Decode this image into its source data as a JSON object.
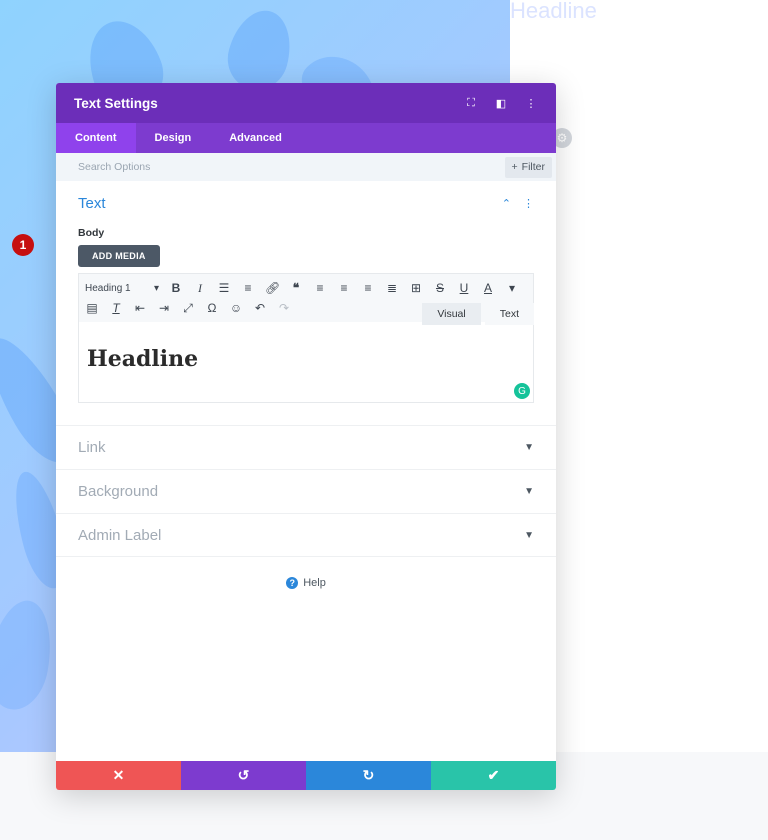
{
  "background": {
    "headline": "Headline"
  },
  "modal": {
    "title": "Text Settings",
    "header_icons": [
      "expand-icon",
      "sidebar-icon",
      "more-icon"
    ],
    "tabs": [
      {
        "label": "Content",
        "active": true
      },
      {
        "label": "Design",
        "active": false
      },
      {
        "label": "Advanced",
        "active": false
      }
    ],
    "search": {
      "placeholder": "Search Options",
      "filter_label": "Filter"
    },
    "text_section": {
      "title": "Text",
      "body_label": "Body",
      "add_media_label": "ADD MEDIA",
      "editor_tabs": [
        {
          "label": "Visual",
          "active": false
        },
        {
          "label": "Text",
          "active": true
        }
      ],
      "format_select": "Heading 1",
      "content": "Headline",
      "badge": "1"
    },
    "collapsed_sections": [
      {
        "title": "Link"
      },
      {
        "title": "Background"
      },
      {
        "title": "Admin Label"
      }
    ],
    "help_label": "Help",
    "footer_colors": {
      "cancel": "#ef5555",
      "undo": "#7d3bcf",
      "redo": "#2b87da",
      "save": "#29c4a9"
    }
  },
  "colors": {
    "header": "#6c2eb9",
    "tabs": "#7d3bcf",
    "accent": "#2b87da"
  }
}
